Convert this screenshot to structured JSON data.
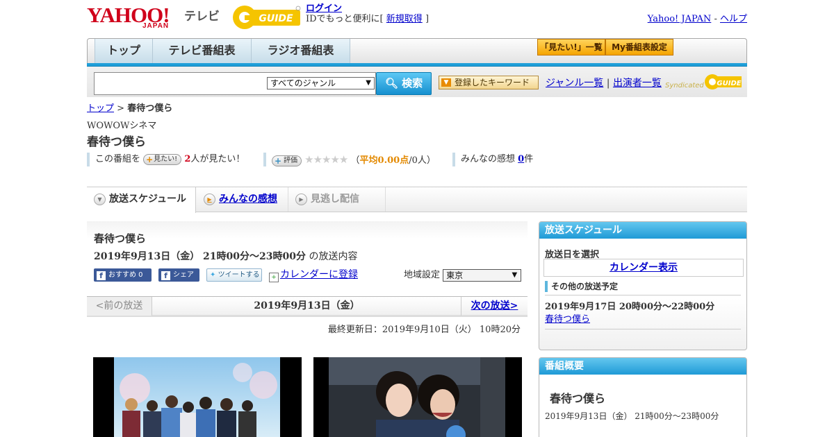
{
  "header": {
    "logo_text": "YAHOO!",
    "logo_sub": "JAPAN",
    "service_name": "テレビ",
    "gguide_logo": "G-GUIDE",
    "login_label": "ログイン",
    "login_hint_prefix": "IDでもっと便利に[",
    "register_label": "新規取得",
    "login_hint_suffix": "]",
    "yahoo_japan_link": "Yahoo! JAPAN",
    "separator": "-",
    "help_link": "ヘルプ"
  },
  "global_nav": {
    "tabs": [
      {
        "label": "トップ"
      },
      {
        "label": "テレビ番組表"
      },
      {
        "label": "ラジオ番組表"
      }
    ],
    "want_list_button": "「見たい!」一覧",
    "my_schedule_button": "My番組表設定"
  },
  "search": {
    "query": "",
    "genre_selected": "すべてのジャンル",
    "search_button": "検索",
    "keyword_button": "登録したキーワード",
    "genre_list_link": "ジャンル一覧",
    "divider": "|",
    "cast_list_link": "出演者一覧",
    "syndicated_text": "Syndicated",
    "syndicated_logo": "G-GUIDE"
  },
  "breadcrumb": {
    "home": "トップ",
    "separator": ">",
    "current": "春待つ僕ら"
  },
  "program": {
    "channel": "WOWOWシネマ",
    "title": "春待つ僕ら",
    "stats": {
      "want_prefix": "この番組を",
      "want_button": "見たい!",
      "want_count": "2",
      "want_suffix": "人が見たい！",
      "rate_button": "評価",
      "stars": "★★★★★",
      "avg_open": "（",
      "avg_label": "平均0.00点",
      "avg_count": "/0人）",
      "impressions_label": "みんなの感想",
      "impressions_count": "0",
      "impressions_unit": "件"
    }
  },
  "tabs": [
    {
      "label": "放送スケジュール",
      "active": true
    },
    {
      "label": "みんなの感想"
    },
    {
      "label": "見逃し配信"
    }
  ],
  "broadcast": {
    "title": "春待つ僕ら",
    "datetime": "2019年9月13日（金）  21時00分～23時00分",
    "datetime_suffix": " の放送内容",
    "recommend_button": "おすすめ 0",
    "share_button": "シェア",
    "tweet_button": "ツイートする",
    "calendar_link": "カレンダーに登録",
    "region_label": "地域設定",
    "region_selected": "東京",
    "prev_label": "<前の放送",
    "current_date": "2019年9月13日（金）",
    "next_label": "次の放送>",
    "last_updated": "最終更新日：2019年9月10日（火）  10時20分"
  },
  "sidebar": {
    "schedule": {
      "heading": "放送スケジュール",
      "select_date_label": "放送日を選択",
      "calendar_link": "カレンダー表示",
      "other_heading": "その他の放送予定",
      "other_items": [
        {
          "when": "2019年9月17日  20時00分～22時00分",
          "title": "春待つ僕ら"
        }
      ]
    },
    "overview": {
      "heading": "番組概要",
      "title": "春待つ僕ら",
      "time": "2019年9月13日（金）  21時00分～23時00分"
    }
  },
  "colors": {
    "brand_red": "#d0021b",
    "accent_blue": "#1f9fd9",
    "link": "#0000cc",
    "gguide_yellow": "#f5c400"
  }
}
